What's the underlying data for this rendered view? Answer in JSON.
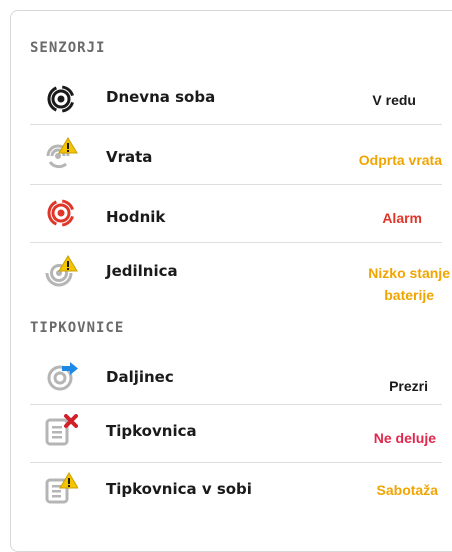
{
  "sections": {
    "sensors_title": "SENZORJI",
    "keypads_title": "TIPKOVNICE"
  },
  "sensors": [
    {
      "name": "Dnevna soba",
      "status": "V redu",
      "icon": "sensor-ok-icon"
    },
    {
      "name": "Vrata",
      "status": "Odprta vrata",
      "icon": "sensor-warning-icon"
    },
    {
      "name": "Hodnik",
      "status": "Alarm",
      "icon": "sensor-alarm-icon"
    },
    {
      "name": "Jedilnica",
      "status_line1": "Nizko stanje",
      "status_line2": "baterije",
      "icon": "sensor-warning-icon"
    }
  ],
  "keypads": [
    {
      "name": "Daljinec",
      "status": "Prezri",
      "icon": "remote-arrow-icon"
    },
    {
      "name": "Tipkovnica",
      "status": "Ne deluje",
      "icon": "keypad-error-icon"
    },
    {
      "name": "Tipkovnica v sobi",
      "status": "Sabotaža",
      "icon": "keypad-warning-icon"
    }
  ],
  "colors": {
    "ok": "#1a1a1a",
    "warning": "#f0a500",
    "alarm": "#e0362a",
    "error": "#e0274d",
    "icon_grey": "#b5b5b5"
  }
}
